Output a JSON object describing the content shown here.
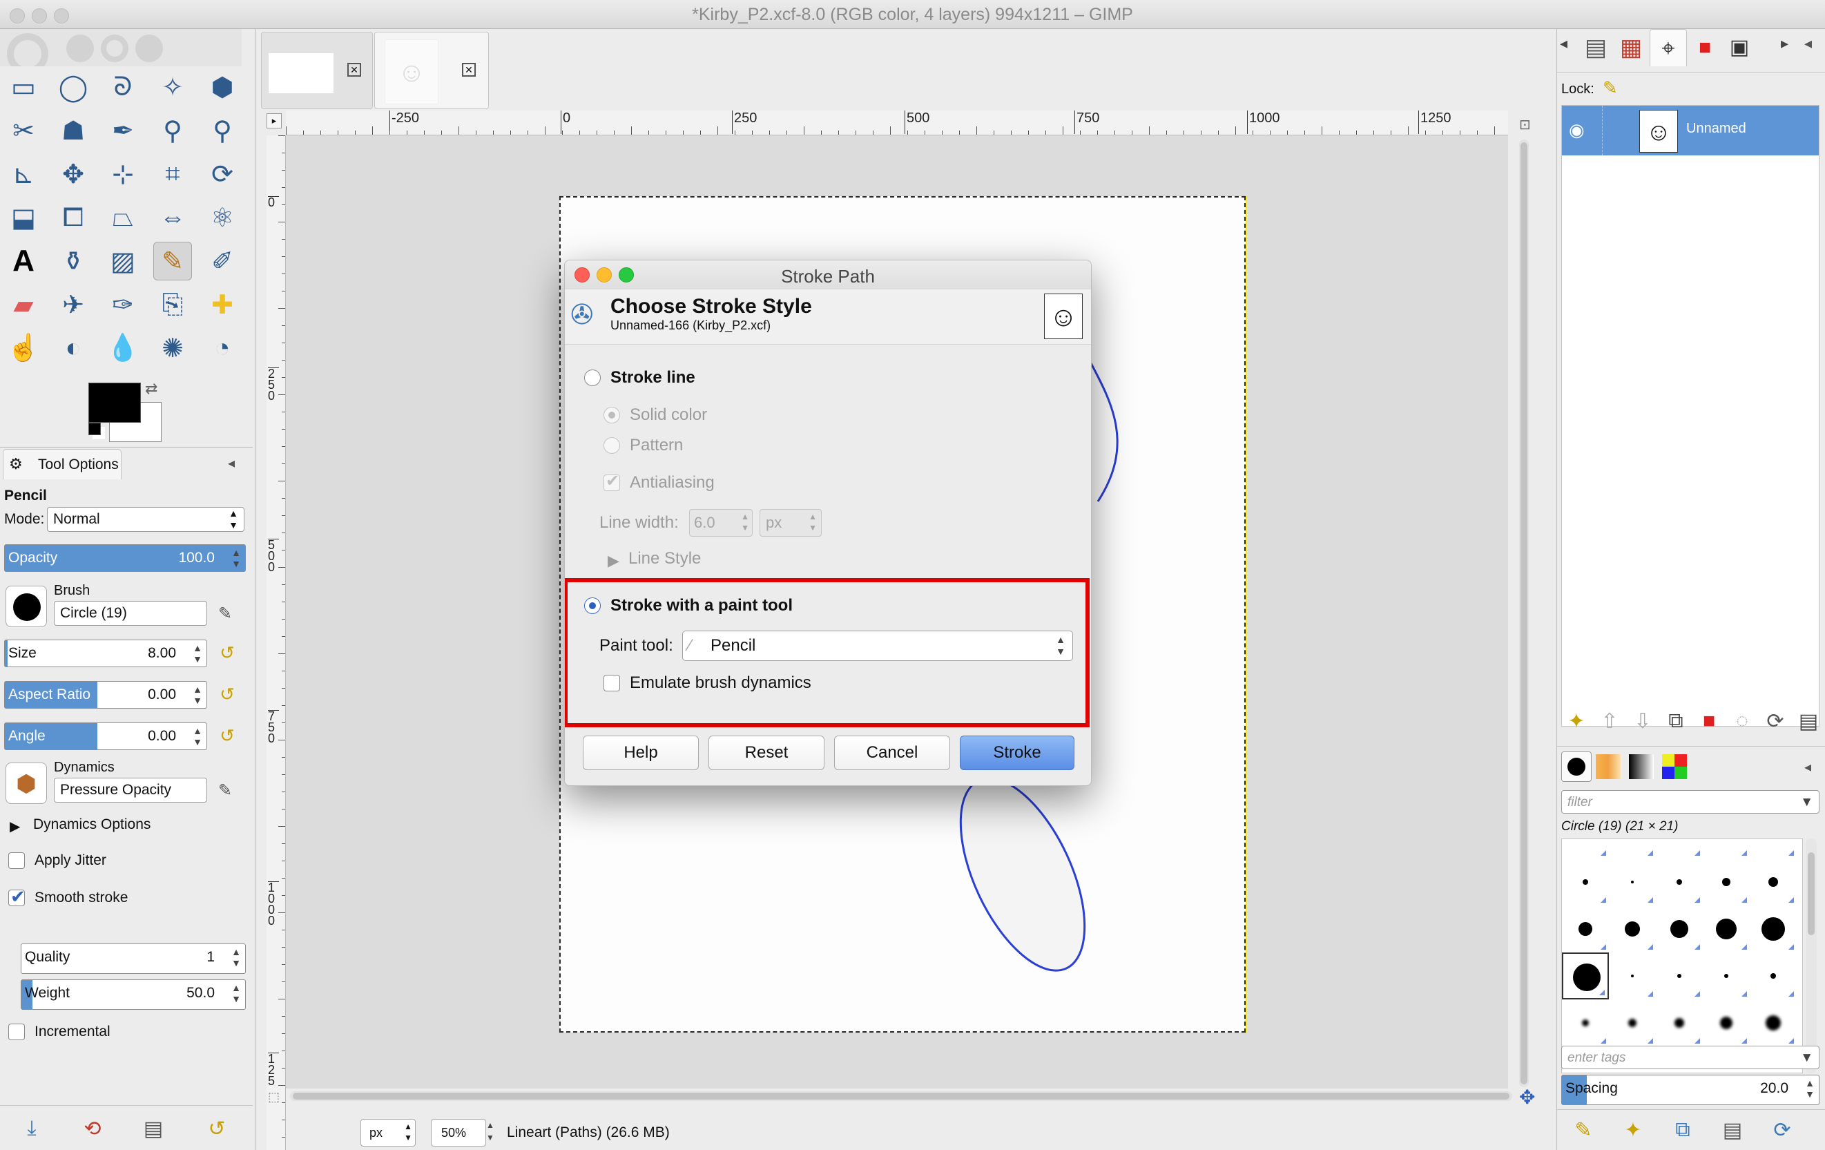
{
  "window": {
    "title": "*Kirby_P2.xcf-8.0 (RGB color, 4 layers) 994x1211 – GIMP"
  },
  "toolbox": {
    "tools": [
      "rect-select",
      "ellipse-select",
      "free-select",
      "fuzzy-select",
      "select-by-color",
      "scissors",
      "foreground-select",
      "paths",
      "color-picker",
      "zoom",
      "measure",
      "move",
      "align",
      "crop",
      "rotate",
      "scale",
      "shear",
      "perspective",
      "flip",
      "cage",
      "text",
      "bucket-fill",
      "blend",
      "pencil",
      "paintbrush",
      "eraser",
      "airbrush",
      "ink",
      "clone",
      "heal",
      "smudge",
      "dodge",
      "blur",
      "convolve",
      "perspective-clone"
    ],
    "active_tool": "pencil"
  },
  "tool_options": {
    "tab_label": "Tool Options",
    "tool_name": "Pencil",
    "mode_label": "Mode:",
    "mode_value": "Normal",
    "opacity_label": "Opacity",
    "opacity_value": "100.0",
    "opacity_fraction": 1.0,
    "brush_label": "Brush",
    "brush_value": "Circle (19)",
    "size_label": "Size",
    "size_value": "8.00",
    "aspect_label": "Aspect Ratio",
    "aspect_value": "0.00",
    "angle_label": "Angle",
    "angle_value": "0.00",
    "dynamics_label": "Dynamics",
    "dynamics_value": "Pressure Opacity",
    "dynamics_options_label": "Dynamics Options",
    "apply_jitter_label": "Apply Jitter",
    "smooth_stroke_label": "Smooth stroke",
    "quality_label": "Quality",
    "quality_value": "1",
    "weight_label": "Weight",
    "weight_value": "50.0",
    "incremental_label": "Incremental"
  },
  "rulers": {
    "h_labels": [
      "-250",
      "0",
      "250",
      "500",
      "750",
      "1000",
      "1250"
    ],
    "v_labels": [
      "0",
      "250",
      "500",
      "750",
      "1000",
      "125"
    ]
  },
  "statusbar": {
    "unit": "px",
    "zoom": "50%",
    "message": "Lineart (Paths) (26.6 MB)"
  },
  "dialog": {
    "title": "Stroke Path",
    "header": "Choose Stroke Style",
    "subheader": "Unnamed-166 (Kirby_P2.xcf)",
    "stroke_line_label": "Stroke line",
    "solid_color_label": "Solid color",
    "pattern_label": "Pattern",
    "antialiasing_label": "Antialiasing",
    "line_width_label": "Line width:",
    "line_width_value": "6.0",
    "line_width_unit": "px",
    "line_style_label": "Line Style",
    "stroke_paint_tool_label": "Stroke with a paint tool",
    "paint_tool_label": "Paint tool:",
    "paint_tool_value": "Pencil",
    "emulate_label": "Emulate brush dynamics",
    "buttons": {
      "help": "Help",
      "reset": "Reset",
      "cancel": "Cancel",
      "stroke": "Stroke"
    },
    "highlight_color": "#e00000"
  },
  "layers": {
    "lock_label": "Lock:",
    "layer_name": "Unnamed"
  },
  "brushes": {
    "filter_placeholder": "filter",
    "selected_brush": "Circle (19) (21 × 21)",
    "tags_placeholder": "enter tags",
    "spacing_label": "Spacing",
    "spacing_value": "20.0"
  }
}
